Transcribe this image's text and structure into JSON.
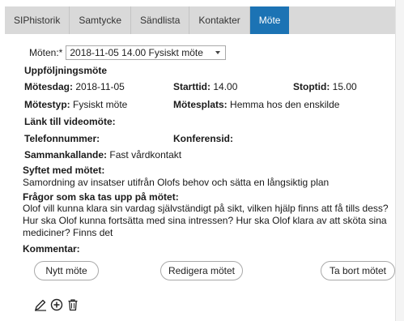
{
  "tabs": [
    {
      "label": "SIPhistorik",
      "active": false
    },
    {
      "label": "Samtycke",
      "active": false
    },
    {
      "label": "Sändlista",
      "active": false
    },
    {
      "label": "Kontakter",
      "active": false
    },
    {
      "label": "Möte",
      "active": true
    }
  ],
  "colors": {
    "tab_active_bg": "#1c73b4",
    "tab_bar_bg": "#d9d9d9"
  },
  "meeting_select": {
    "label": "Möten:*",
    "value": "2018-11-05 14.00 Fysiskt möte"
  },
  "section_title": "Uppföljningsmöte",
  "fields": {
    "date_label": "Mötesdag:",
    "date_value": "2018-11-05",
    "start_label": "Starttid:",
    "start_value": "14.00",
    "stop_label": "Stoptid:",
    "stop_value": "15.00",
    "type_label": "Mötestyp:",
    "type_value": "Fysiskt möte",
    "place_label": "Mötesplats:",
    "place_value": "Hemma hos den enskilde",
    "video_label": "Länk till videomöte:",
    "phone_label": "Telefonnummer:",
    "conf_label": "Konferensid:",
    "caller_label": "Sammankallande:",
    "caller_value": "Fast vårdkontakt"
  },
  "purpose": {
    "label": "Syftet med mötet:",
    "text": "Samordning av insatser utifrån Olofs behov och sätta en långsiktig plan"
  },
  "questions": {
    "label": "Frågor som ska tas upp på mötet:",
    "text": "Olof vill kunna klara sin vardag självständigt på sikt, vilken hjälp finns att få tills dess? Hur ska Olof kunna fortsätta med sina intressen? Hur ska Olof klara av att sköta sina mediciner? Finns det"
  },
  "comment_label": "Kommentar:",
  "buttons": {
    "new": "Nytt möte",
    "edit": "Redigera mötet",
    "delete": "Ta bort mötet"
  },
  "icons": [
    "pencil-icon",
    "plus-circle-icon",
    "trash-icon"
  ]
}
